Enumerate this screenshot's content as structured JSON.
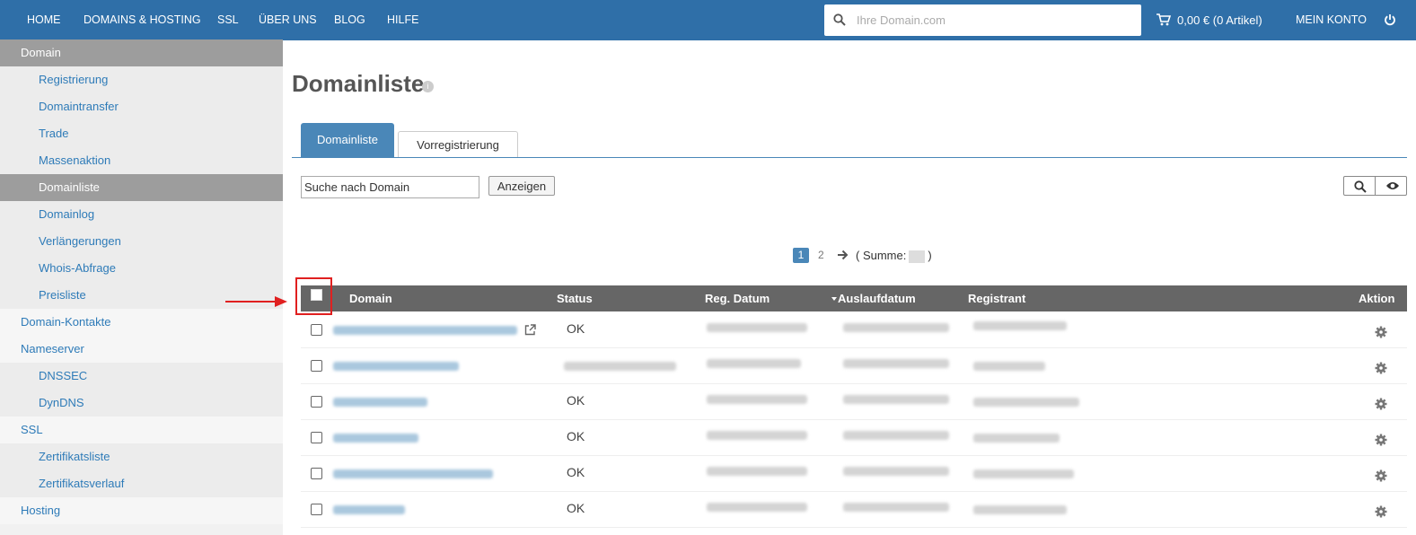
{
  "nav": {
    "items": [
      "HOME",
      "DOMAINS & HOSTING",
      "SSL",
      "ÜBER UNS",
      "BLOG",
      "HILFE"
    ],
    "search_placeholder": "Ihre Domain.com",
    "cart": "0,00 € (0 Artikel)",
    "account": "MEIN KONTO"
  },
  "sidebar": {
    "items": [
      {
        "label": "Domain",
        "level": "top",
        "active": true
      },
      {
        "label": "Registrierung",
        "level": "sub"
      },
      {
        "label": "Domaintransfer",
        "level": "sub"
      },
      {
        "label": "Trade",
        "level": "sub"
      },
      {
        "label": "Massenaktion",
        "level": "sub"
      },
      {
        "label": "Domainliste",
        "level": "sub",
        "active": true
      },
      {
        "label": "Domainlog",
        "level": "sub"
      },
      {
        "label": "Verlängerungen",
        "level": "sub"
      },
      {
        "label": "Whois-Abfrage",
        "level": "sub"
      },
      {
        "label": "Preisliste",
        "level": "sub"
      },
      {
        "label": "Domain-Kontakte",
        "level": "top"
      },
      {
        "label": "Nameserver",
        "level": "top"
      },
      {
        "label": "DNSSEC",
        "level": "sub"
      },
      {
        "label": "DynDNS",
        "level": "sub"
      },
      {
        "label": "SSL",
        "level": "top"
      },
      {
        "label": "Zertifikatsliste",
        "level": "sub"
      },
      {
        "label": "Zertifikatsverlauf",
        "level": "sub"
      },
      {
        "label": "Hosting",
        "level": "top"
      }
    ]
  },
  "main": {
    "title": "Domainliste",
    "tabs": [
      "Domainliste",
      "Vorregistrierung"
    ],
    "search_placeholder": "Suche nach Domain",
    "show_button": "Anzeigen",
    "pager": {
      "current": "1",
      "next": "2",
      "sum_label": "( Summe:",
      "sum_close": ")"
    }
  },
  "table": {
    "columns": [
      "Domain",
      "Status",
      "Reg. Datum",
      "Auslaufdatum",
      "Registrant",
      "Aktion"
    ],
    "rows": [
      {
        "status": "OK"
      },
      {
        "status": ""
      },
      {
        "status": "OK"
      },
      {
        "status": "OK"
      },
      {
        "status": "OK"
      },
      {
        "status": "OK"
      }
    ]
  },
  "colors": {
    "nav_bg": "#2f6fa8",
    "accent": "#4a87b8",
    "table_head": "#666666",
    "annotation": "#e02020"
  },
  "icons": [
    "search-icon",
    "cart-icon",
    "power-icon",
    "info-icon",
    "arrow-right-icon",
    "external-link-icon",
    "eye-icon",
    "gear-icon"
  ]
}
